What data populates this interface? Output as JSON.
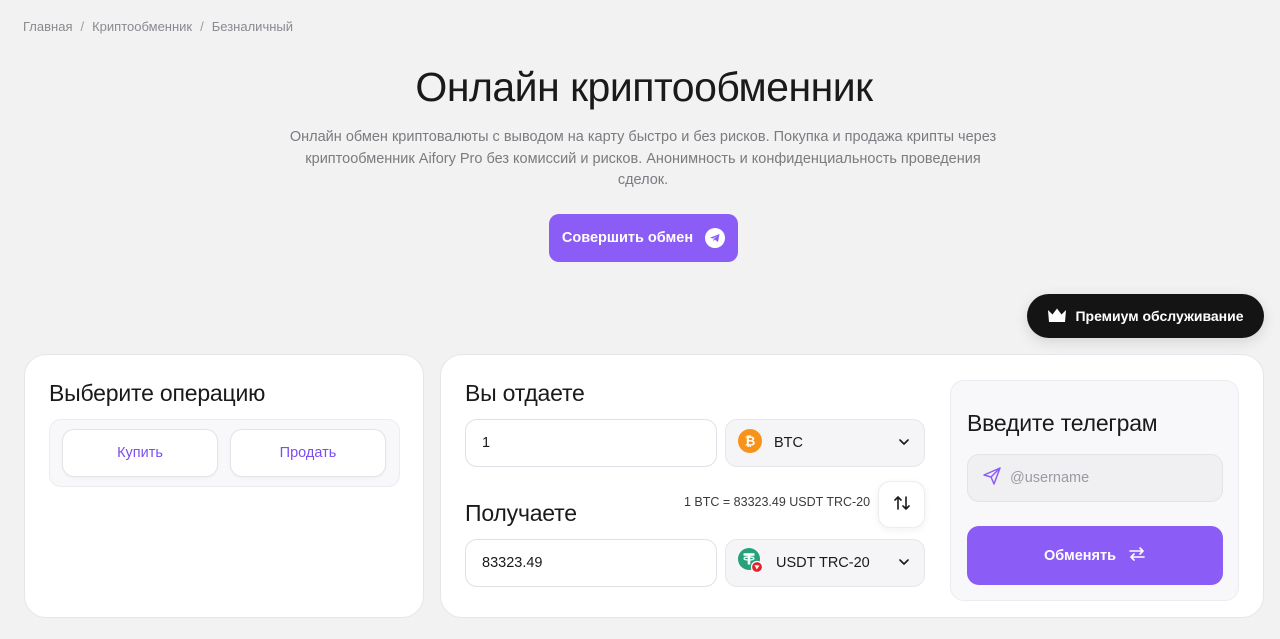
{
  "breadcrumb": {
    "items": [
      "Главная",
      "Криптообменник",
      "Безналичный"
    ],
    "separator": "/"
  },
  "hero": {
    "title": "Онлайн криптообменник",
    "subtitle": "Онлайн обмен криптовалюты с выводом на карту быстро и без рисков. Покупка и продажа крипты через криптообменник Aifory Pro без комиссий и рисков. Анонимность и конфиденциальность проведения сделок.",
    "cta_label": "Совершить обмен"
  },
  "premium": {
    "label": "Премиум обслуживание"
  },
  "operation": {
    "title": "Выберите операцию",
    "buy_label": "Купить",
    "sell_label": "Продать"
  },
  "give": {
    "title": "Вы отдаете",
    "amount": "1",
    "currency": "BTC"
  },
  "receive": {
    "title": "Получаете",
    "amount": "83323.49",
    "currency": "USDT TRC-20"
  },
  "rate": {
    "text": "1 BTC = 83323.49 USDT TRC-20"
  },
  "telegram": {
    "title": "Введите телеграм",
    "placeholder": "@username",
    "submit_label": "Обменять"
  },
  "colors": {
    "accent": "#8b5cf6",
    "btc": "#f7931a",
    "usdt": "#26a17b",
    "tron": "#e5202a",
    "dark": "#141414"
  }
}
